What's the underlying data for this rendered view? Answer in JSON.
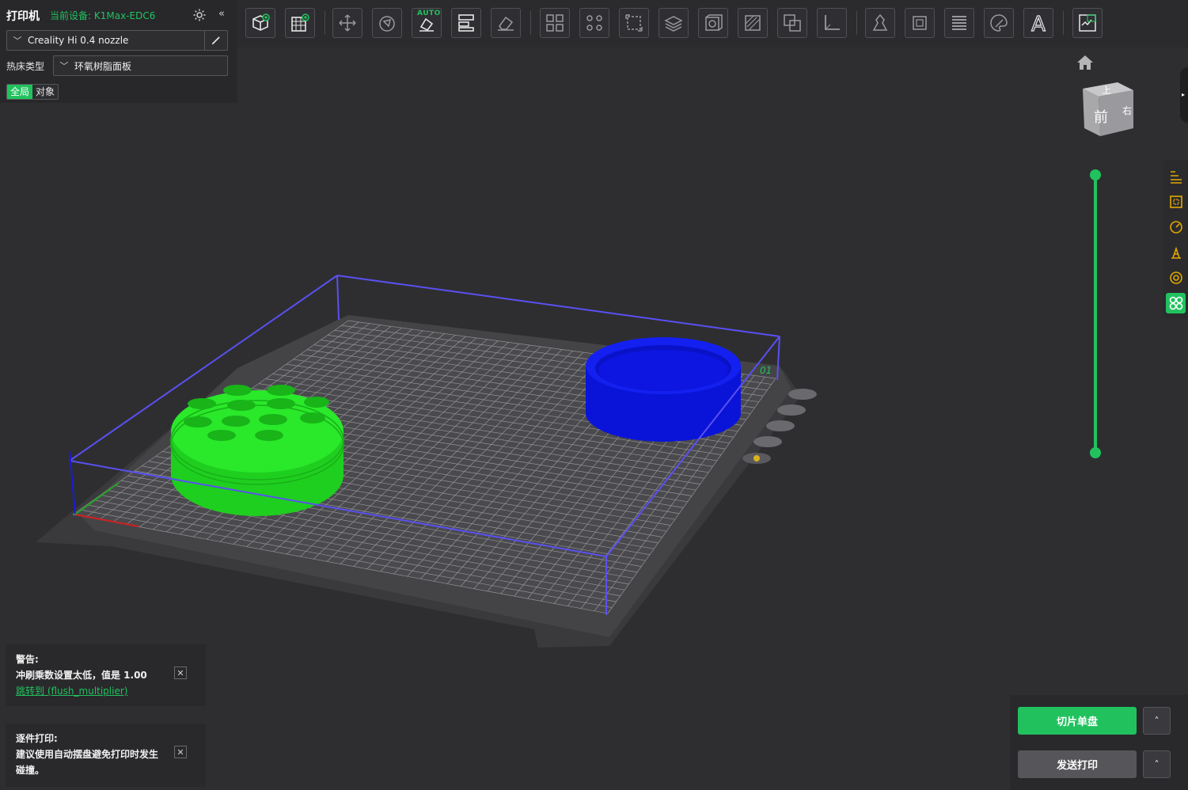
{
  "left_panel": {
    "title": "打印机",
    "current_device": "当前设备: K1Max-EDC6",
    "collapse_label": "«",
    "printer_profile": "Creality Hi 0.4 nozzle",
    "bed_type_label": "热床类型",
    "bed_type_value": "环氧树脂面板",
    "scope_global": "全局",
    "scope_object": "对象"
  },
  "toolbar": {
    "auto_tag": "AUTO",
    "buttons": [
      "add-object",
      "add-plate",
      "auto-orient",
      "arrange",
      "auto-arrange",
      "split",
      "lay-on-face",
      "split-to-objects",
      "split-to-parts",
      "scale",
      "cut",
      "hollow",
      "support-paint",
      "boolean",
      "measure",
      "seam-paint",
      "mesh-repair",
      "variable-layer",
      "color-paint",
      "text-emboss",
      "assembly-view"
    ],
    "text_tool_label": "A"
  },
  "viewport": {
    "cube_top_label": "上",
    "cube_front_label": "前",
    "cube_right_label": "右",
    "plate_number": "01",
    "right_edge_arrow": "▸"
  },
  "notices": [
    {
      "title": "警告:",
      "line1": "冲刷乘数设置太低，值是 1.00",
      "link": "跳转到 (flush_multiplier)",
      "close": "✕"
    },
    {
      "title": "逐件打印:",
      "line1": "建议使用自动摆盘避免打印时发生",
      "line2": "碰撞。",
      "close": "✕"
    }
  ],
  "actions": {
    "slice_label": "切片单盘",
    "send_label": "发送打印",
    "expand_label": "˄"
  },
  "colors": {
    "accent": "#21c25e",
    "object_green": "#1fdc1f",
    "object_blue": "#0a14e6",
    "bounding_box": "#5a50f0"
  }
}
